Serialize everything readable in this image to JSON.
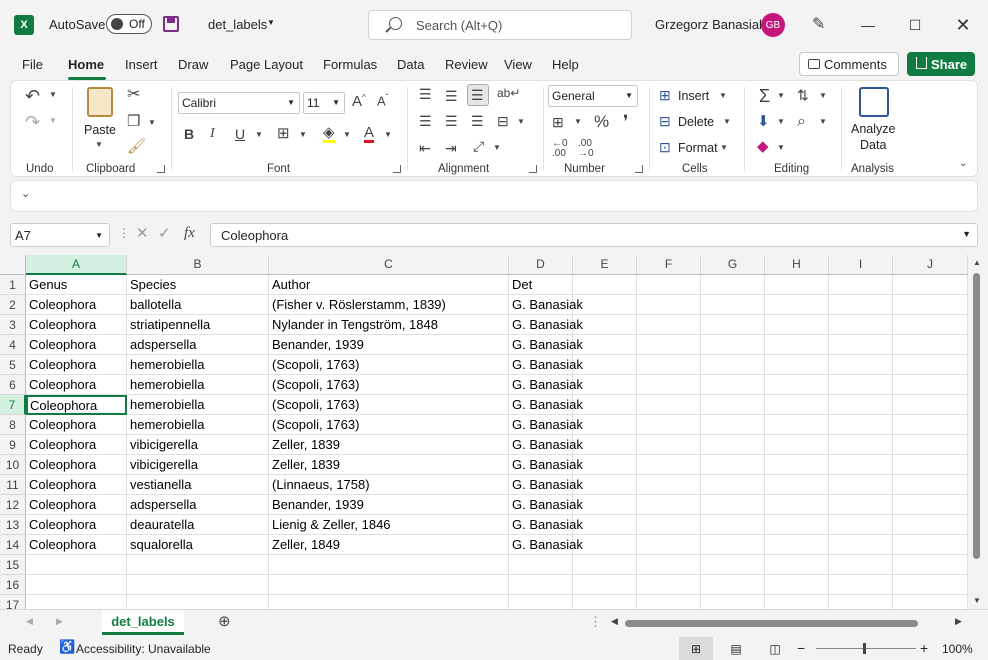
{
  "titlebar": {
    "autosave_label": "AutoSave",
    "autosave_state": "Off",
    "doc_title": "det_labels",
    "search_placeholder": "Search (Alt+Q)",
    "user_name": "Grzegorz Banasiak",
    "user_initials": "GB"
  },
  "tabs": [
    "File",
    "Home",
    "Insert",
    "Draw",
    "Page Layout",
    "Formulas",
    "Data",
    "Review",
    "View",
    "Help"
  ],
  "active_tab": "Home",
  "actions": {
    "comments": "Comments",
    "share": "Share"
  },
  "ribbon": {
    "groups": {
      "undo": "Undo",
      "clipboard": "Clipboard",
      "font": "Font",
      "alignment": "Alignment",
      "number": "Number",
      "cells": "Cells",
      "editing": "Editing",
      "analysis": "Analysis"
    },
    "paste_label": "Paste",
    "font_name": "Calibri",
    "font_size": "11",
    "number_format": "General",
    "insert_label": "Insert",
    "delete_label": "Delete",
    "format_label": "Format",
    "analyze_label_1": "Analyze",
    "analyze_label_2": "Data"
  },
  "formula_bar": {
    "name_box": "A7",
    "formula": "Coleophora"
  },
  "columns": [
    "A",
    "B",
    "C",
    "D",
    "E",
    "F",
    "G",
    "H",
    "I",
    "J"
  ],
  "selected_column": "A",
  "selected_row": 7,
  "rows": [
    [
      "Genus",
      "Species",
      "Author",
      "Det"
    ],
    [
      "Coleophora",
      "ballotella",
      "(Fisher v. Röslerstamm, 1839)",
      "G. Banasiak"
    ],
    [
      "Coleophora",
      "striatipennella",
      "Nylander in Tengström, 1848",
      "G. Banasiak"
    ],
    [
      "Coleophora",
      "adspersella",
      "Benander, 1939",
      "G. Banasiak"
    ],
    [
      "Coleophora",
      "hemerobiella",
      "(Scopoli, 1763)",
      "G. Banasiak"
    ],
    [
      "Coleophora",
      "hemerobiella",
      "(Scopoli, 1763)",
      "G. Banasiak"
    ],
    [
      "Coleophora",
      "hemerobiella",
      "(Scopoli, 1763)",
      "G. Banasiak"
    ],
    [
      "Coleophora",
      "hemerobiella",
      "(Scopoli, 1763)",
      "G. Banasiak"
    ],
    [
      "Coleophora",
      "vibicigerella",
      "Zeller, 1839",
      "G. Banasiak"
    ],
    [
      "Coleophora",
      "vibicigerella",
      "Zeller, 1839",
      "G. Banasiak"
    ],
    [
      "Coleophora",
      "vestianella",
      "(Linnaeus, 1758)",
      "G. Banasiak"
    ],
    [
      "Coleophora",
      "adspersella",
      "Benander, 1939",
      "G. Banasiak"
    ],
    [
      "Coleophora",
      "deauratella",
      "Lienig & Zeller, 1846",
      "G. Banasiak"
    ],
    [
      "Coleophora",
      "squalorella",
      "Zeller, 1849",
      "G. Banasiak"
    ],
    [
      "",
      "",
      "",
      ""
    ],
    [
      "",
      "",
      "",
      ""
    ],
    [
      "",
      "",
      "",
      ""
    ]
  ],
  "sheet_tab": "det_labels",
  "status": {
    "ready": "Ready",
    "accessibility": "Accessibility: Unavailable",
    "zoom": "100%"
  },
  "colors": {
    "accent": "#107c41",
    "avatar": "#c4177c"
  }
}
